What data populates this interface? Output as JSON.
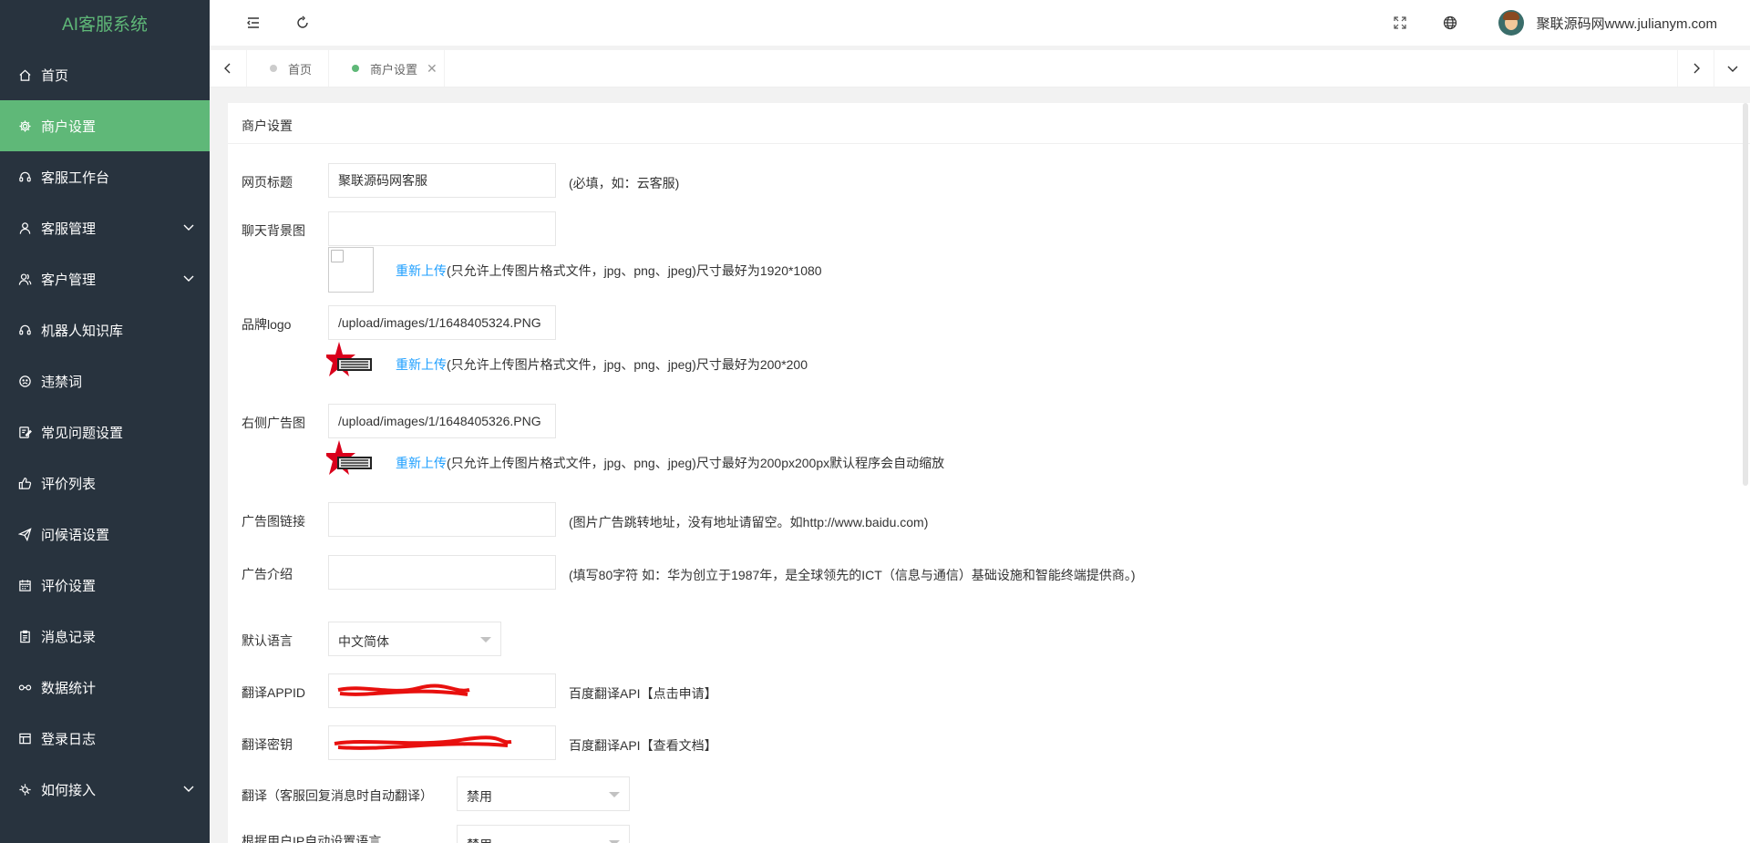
{
  "app": {
    "title": "AI客服系统"
  },
  "colors": {
    "accent": "#5fb878",
    "sidebar_bg": "#28333e",
    "link": "#1e9fff"
  },
  "sidebar": {
    "items": [
      {
        "label": "首页",
        "icon": "home-icon"
      },
      {
        "label": "商户设置",
        "icon": "gear-icon",
        "active": true
      },
      {
        "label": "客服工作台",
        "icon": "headset-icon"
      },
      {
        "label": "客服管理",
        "icon": "user-icon",
        "expandable": true
      },
      {
        "label": "客户管理",
        "icon": "users-icon",
        "expandable": true
      },
      {
        "label": "机器人知识库",
        "icon": "robot-icon"
      },
      {
        "label": "违禁词",
        "icon": "face-icon"
      },
      {
        "label": "常见问题设置",
        "icon": "edit-icon"
      },
      {
        "label": "评价列表",
        "icon": "thumb-up-icon"
      },
      {
        "label": "问候语设置",
        "icon": "send-icon"
      },
      {
        "label": "评价设置",
        "icon": "calendar-icon"
      },
      {
        "label": "消息记录",
        "icon": "clipboard-icon"
      },
      {
        "label": "数据统计",
        "icon": "chart-link-icon"
      },
      {
        "label": "登录日志",
        "icon": "log-table-icon"
      },
      {
        "label": "如何接入",
        "icon": "plug-icon",
        "expandable": true
      }
    ]
  },
  "header": {
    "icons": [
      "collapse-menu-icon",
      "refresh-icon",
      "fullscreen-icon",
      "globe-icon"
    ],
    "user": {
      "name": "聚联源码网www.julianym.com"
    }
  },
  "tabs": {
    "items": [
      {
        "label": "首页",
        "active": false
      },
      {
        "label": "商户设置",
        "active": true
      }
    ]
  },
  "form": {
    "card_title": "商户设置",
    "page_title": {
      "label": "网页标题",
      "value": "聚联源码网客服",
      "hint": "(必填，如：云客服)"
    },
    "chat_bg": {
      "label": "聊天背景图",
      "value": "",
      "reupload": "重新上传",
      "hint": "(只允许上传图片格式文件，jpg、png、jpeg)尺寸最好为1920*1080"
    },
    "brand_logo": {
      "label": "品牌logo",
      "value": "/upload/images/1/1648405324.PNG",
      "reupload": "重新上传",
      "hint": "(只允许上传图片格式文件，jpg、png、jpeg)尺寸最好为200*200"
    },
    "right_ad": {
      "label": "右侧广告图",
      "value": "/upload/images/1/1648405326.PNG",
      "reupload": "重新上传",
      "hint": "(只允许上传图片格式文件，jpg、png、jpeg)尺寸最好为200px200px默认程序会自动缩放"
    },
    "ad_link": {
      "label": "广告图链接",
      "value": "",
      "hint": "(图片广告跳转地址，没有地址请留空。如http://www.baidu.com)"
    },
    "ad_intro": {
      "label": "广告介绍",
      "value": "",
      "hint": "(填写80字符 如：华为创立于1987年，是全球领先的ICT（信息与通信）基础设施和智能终端提供商。)"
    },
    "default_lang": {
      "label": "默认语言",
      "value": "中文简体"
    },
    "appid": {
      "label": "翻译APPID",
      "hint": "百度翻译API【点击申请】"
    },
    "secret": {
      "label": "翻译密钥",
      "hint": "百度翻译API【查看文档】"
    },
    "auto_translate": {
      "label": "翻译（客服回复消息时自动翻译）",
      "value": "禁用"
    },
    "ip_lang": {
      "label": "根据用户IP自动设置语言",
      "value": "禁用"
    }
  }
}
